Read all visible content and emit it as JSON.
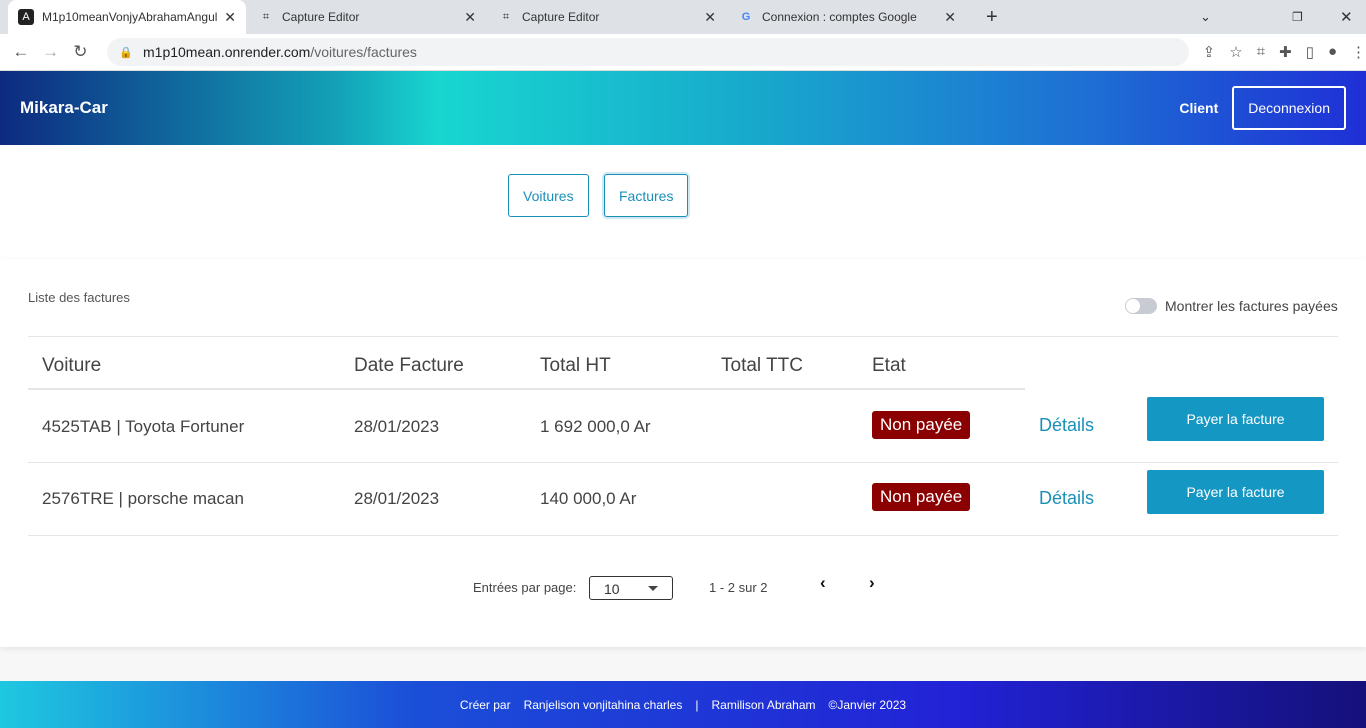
{
  "browser": {
    "tabs": [
      {
        "title": "M1p10meanVonjyAbrahamAngul",
        "icon": "angular-icon"
      },
      {
        "title": "Capture Editor",
        "icon": "capture-icon"
      },
      {
        "title": "Capture Editor",
        "icon": "capture-icon"
      },
      {
        "title": "Connexion : comptes Google",
        "icon": "google-icon"
      }
    ],
    "url_host": "m1p10mean.onrender.com",
    "url_path": "/voitures/factures"
  },
  "header": {
    "brand": "Mikara-Car",
    "role": "Client",
    "logout": "Deconnexion"
  },
  "nav": {
    "voitures": "Voitures",
    "factures": "Factures"
  },
  "card": {
    "title": "Liste des factures",
    "toggle_label": "Montrer les factures payées",
    "toggle_on": false,
    "columns": [
      "Voiture",
      "Date Facture",
      "Total HT",
      "Total TTC",
      "Etat"
    ],
    "rows": [
      {
        "voiture": "4525TAB | Toyota Fortuner",
        "date": "28/01/2023",
        "total_ht": "1 692 000,0 Ar",
        "total_ttc": "",
        "etat": "Non payée",
        "details": "Détails",
        "pay": "Payer la facture"
      },
      {
        "voiture": "2576TRE | porsche macan",
        "date": "28/01/2023",
        "total_ht": "140 000,0 Ar",
        "total_ttc": "",
        "etat": "Non payée",
        "details": "Détails",
        "pay": "Payer la facture"
      }
    ],
    "pagination": {
      "label": "Entrées par page:",
      "page_size": "10",
      "range": "1 - 2 sur 2"
    }
  },
  "footer": {
    "created": "Créer par",
    "author1": "Ranjelison vonjitahina charles",
    "sep": "|",
    "author2": "Ramilison Abraham",
    "copyright": "©Janvier 2023"
  }
}
